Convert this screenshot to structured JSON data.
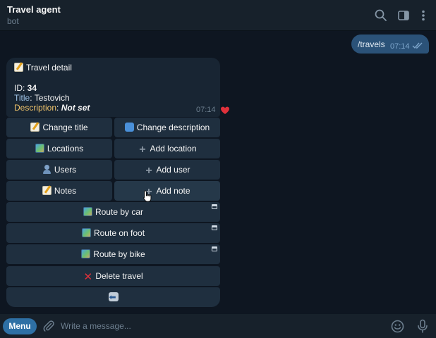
{
  "header": {
    "title": "Travel agent",
    "subtitle": "bot",
    "icons": [
      "search-icon",
      "sidebar-toggle-icon",
      "more-vertical-icon"
    ]
  },
  "outgoing": {
    "text": "/travels",
    "time": "07:14",
    "status": "read"
  },
  "incoming": {
    "title": "Travel detail",
    "id_label": "ID: ",
    "id_value": "34",
    "title_label": "Title",
    "title_sep": ": ",
    "title_value": "Testovich",
    "desc_label": "Description",
    "desc_sep": ": ",
    "desc_value": "Not set",
    "time": "07:14",
    "reaction": "heart-icon"
  },
  "keyboard": {
    "change_title": "Change title",
    "change_description": "Change description",
    "locations": "Locations",
    "add_location": "Add location",
    "users": "Users",
    "add_user": "Add user",
    "notes": "Notes",
    "add_note": "Add note",
    "route_car": "Route by car",
    "route_foot": "Route on foot",
    "route_bike": "Route by bike",
    "delete_travel": "Delete travel",
    "back_icon": "back-arrow-icon"
  },
  "composer": {
    "menu_label": "Menu",
    "placeholder": "Write a message..."
  },
  "colors": {
    "background": "#0e1621",
    "header": "#17212b",
    "outgoing_bubble": "#2b5278",
    "incoming_bubble": "#182533",
    "keyboard_button": "#1f2f3f",
    "menu_button": "#2e70a5",
    "muted_text": "#6d7f8f"
  }
}
